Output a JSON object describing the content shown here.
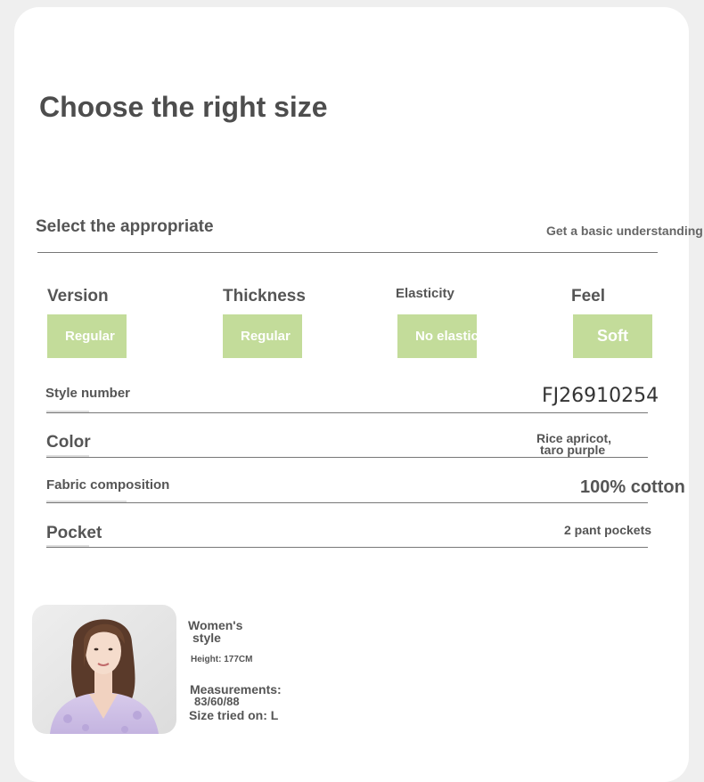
{
  "header": {
    "title": "Choose the right size"
  },
  "section": {
    "heading": "Select the appropriate",
    "side_note": "Get a basic understanding"
  },
  "attributes": [
    {
      "label": "Version",
      "value": "Regular"
    },
    {
      "label": "Thickness",
      "value": "Regular"
    },
    {
      "label": "Elasticity",
      "value": "No elasticity"
    },
    {
      "label": "Feel",
      "value": "Soft"
    }
  ],
  "chip_color": "#c3dc9a",
  "details": {
    "style_number": {
      "label": "Style number",
      "value": "FJ26910254"
    },
    "color": {
      "label": "Color",
      "value_line1": "Rice apricot,",
      "value_line2": "taro purple"
    },
    "fabric": {
      "label": "Fabric composition",
      "value": "100% cotton"
    },
    "pocket": {
      "label": "Pocket",
      "value": "2 pant pockets"
    }
  },
  "model": {
    "style_line1": "Women's",
    "style_line2": "style",
    "height": "Height: 177CM",
    "measurements_label": "Measurements:",
    "measurements_value": "83/60/88",
    "size_tried": "Size tried on: L"
  }
}
